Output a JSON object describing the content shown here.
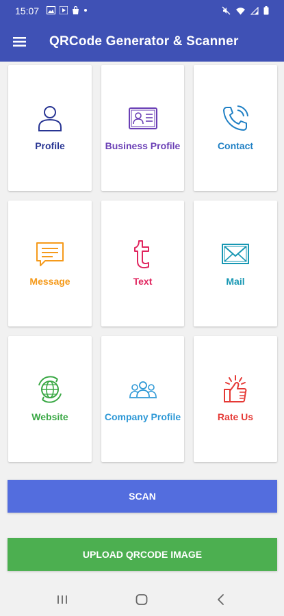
{
  "status": {
    "time": "15:07"
  },
  "app": {
    "title": "QRCode Generator & Scanner"
  },
  "cards": [
    {
      "label": "Profile",
      "icon": "person-icon",
      "color": "#283593"
    },
    {
      "label": "Business Profile",
      "icon": "id-card-icon",
      "color": "#6a3fb5"
    },
    {
      "label": "Contact",
      "icon": "phone-icon",
      "color": "#1e7fc4"
    },
    {
      "label": "Message",
      "icon": "chat-icon",
      "color": "#f59a1b"
    },
    {
      "label": "Text",
      "icon": "text-t-icon",
      "color": "#e0245e"
    },
    {
      "label": "Mail",
      "icon": "envelope-icon",
      "color": "#1797b3"
    },
    {
      "label": "Website",
      "icon": "globe-icon",
      "color": "#3aa845"
    },
    {
      "label": "Company Profile",
      "icon": "group-icon",
      "color": "#2d98d6"
    },
    {
      "label": "Rate Us",
      "icon": "thumbs-up-icon",
      "color": "#e53935"
    }
  ],
  "buttons": {
    "scan": "SCAN",
    "upload": "UPLOAD QRCODE IMAGE"
  },
  "colors": {
    "appbar": "#3f51b5",
    "scan": "#536dde",
    "upload": "#4caf50",
    "background": "#f1f1f1"
  }
}
